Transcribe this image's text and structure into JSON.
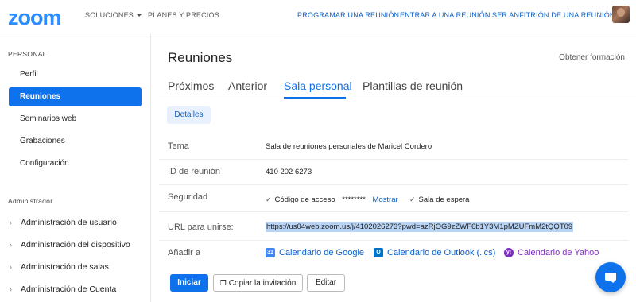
{
  "header": {
    "logo": "zoom",
    "nav_left": [
      {
        "label": "SOLUCIONES",
        "has_caret": true
      },
      {
        "label": "PLANES Y PRECIOS",
        "has_caret": false
      }
    ],
    "nav_right": [
      {
        "label": "PROGRAMAR UNA REUNIÓN"
      },
      {
        "label": "ENTRAR A UNA REUNIÓN"
      },
      {
        "label": "SER ANFITRIÓN DE UNA REUNIÓN"
      }
    ]
  },
  "sidebar": {
    "personal_title": "PERSONAL",
    "personal_items": [
      {
        "label": "Perfil"
      },
      {
        "label": "Reuniones"
      },
      {
        "label": "Seminarios web"
      },
      {
        "label": "Grabaciones"
      },
      {
        "label": "Configuración"
      }
    ],
    "admin_title": "Administrador",
    "admin_items": [
      {
        "label": "Administración de usuario"
      },
      {
        "label": "Administración del dispositivo"
      },
      {
        "label": "Administración de salas"
      },
      {
        "label": "Administración de Cuenta"
      }
    ]
  },
  "main": {
    "title": "Reuniones",
    "training_link": "Obtener formación",
    "tabs": [
      {
        "label": "Próximos"
      },
      {
        "label": "Anterior"
      },
      {
        "label": "Sala personal"
      },
      {
        "label": "Plantillas de reunión"
      }
    ],
    "details_button": "Detalles",
    "topic_label": "Tema",
    "topic_value": "Sala de reuniones personales de Maricel Cordero",
    "meeting_id_label": "ID de reunión",
    "meeting_id_value": "410 202 6273",
    "security_label": "Seguridad",
    "passcode_label": "Código de acceso",
    "passcode_value": "********",
    "show_link": "Mostrar",
    "waiting_room": "Sala de espera",
    "url_label": "URL para unirse:",
    "url_value": "https://us04web.zoom.us/j/4102026273?pwd=azRjOG9zZWF6b1Y3M1pMZUFmM2tQQT09",
    "add_label": "Añadir a",
    "calendars": {
      "google": "Calendario de Google",
      "outlook": "Calendario de Outlook (.ics)",
      "yahoo": "Calendario de Yahoo"
    },
    "start_button": "Iniciar",
    "copy_button": "Copiar la invitación",
    "edit_button": "Editar"
  },
  "colors": {
    "brand": "#2d8cff",
    "accent": "#0e72ed",
    "link": "#0e5fc5",
    "google_cal": "#4285f4",
    "outlook": "#0072c6",
    "yahoo": "#7b2fbf"
  }
}
